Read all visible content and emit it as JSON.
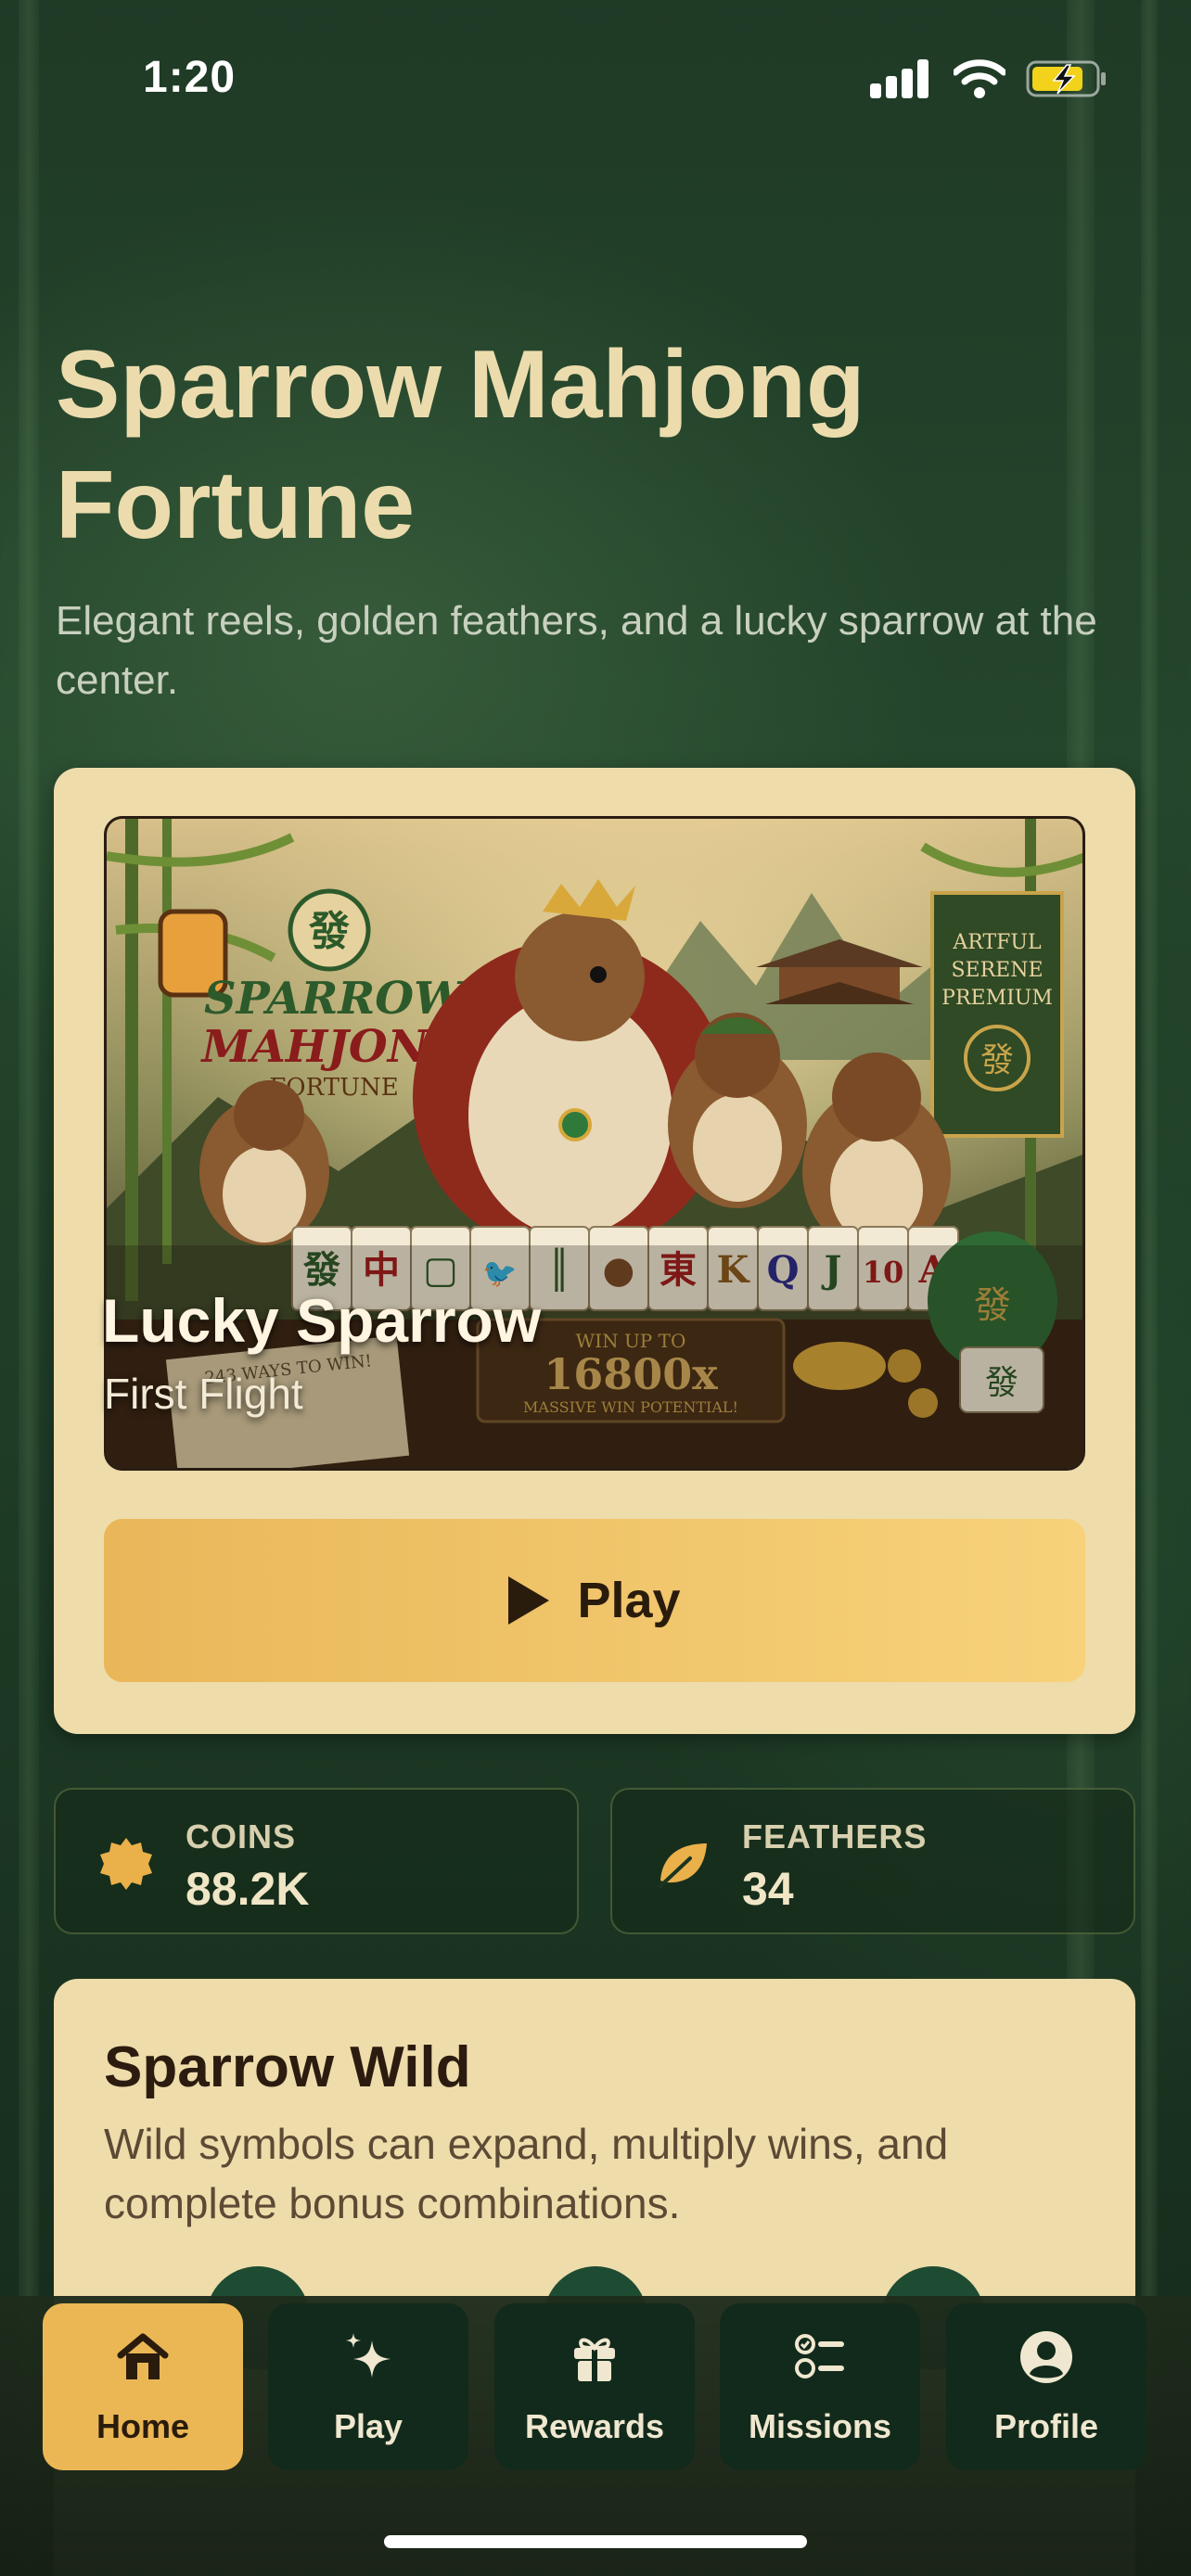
{
  "status_bar": {
    "time": "1:20",
    "icons": [
      "cellular-signal-icon",
      "wifi-icon",
      "battery-charging-icon"
    ],
    "battery_color": "#f2d21b"
  },
  "header": {
    "title": "Sparrow Mahjong Fortune",
    "subtitle": "Elegant reels, golden feathers, and a lucky sparrow at the center."
  },
  "hero": {
    "image_alt": "Sparrow Mahjong Fortune game artwork",
    "title": "Lucky Sparrow",
    "subtitle": "First Flight",
    "play_label": "Play",
    "play_icon": "play-icon",
    "artwork_text": {
      "logo_glyph": "發",
      "logo_line1": "SPARROW",
      "logo_line2": "MAHJONG",
      "logo_line3": "FORTUNE",
      "banner_line1": "ARTFUL",
      "banner_line2": "SERENE",
      "banner_line3": "PREMIUM",
      "banner_glyph": "發",
      "tiles": [
        "發",
        "中",
        "▢",
        "🐦",
        "║",
        "●",
        "東",
        "K",
        "Q",
        "J",
        "10",
        "A"
      ],
      "win_line1": "WIN UP TO",
      "win_amount": "16800x",
      "win_line3": "MASSIVE WIN POTENTIAL!",
      "scroll_text": "243 WAYS TO WIN!",
      "pot_glyph": "發",
      "tile_glyph": "發"
    }
  },
  "stats": [
    {
      "label": "COINS",
      "value": "88.2K",
      "icon": "coin-icon"
    },
    {
      "label": "FEATHERS",
      "value": "34",
      "icon": "feather-leaf-icon"
    }
  ],
  "info_card": {
    "title": "Sparrow Wild",
    "text": "Wild symbols can expand, multiply wins, and complete bonus combinations."
  },
  "tabs": [
    {
      "label": "Home",
      "icon": "house-icon",
      "active": true
    },
    {
      "label": "Play",
      "icon": "sparkles-icon",
      "active": false
    },
    {
      "label": "Rewards",
      "icon": "gift-icon",
      "active": false
    },
    {
      "label": "Missions",
      "icon": "checklist-icon",
      "active": false
    },
    {
      "label": "Profile",
      "icon": "person-circle-icon",
      "active": false
    }
  ],
  "colors": {
    "accent_gold": "#ebb755",
    "card_cream": "#eedcab",
    "title_cream": "#ecdcad",
    "forest_green": "#1f3a26"
  }
}
